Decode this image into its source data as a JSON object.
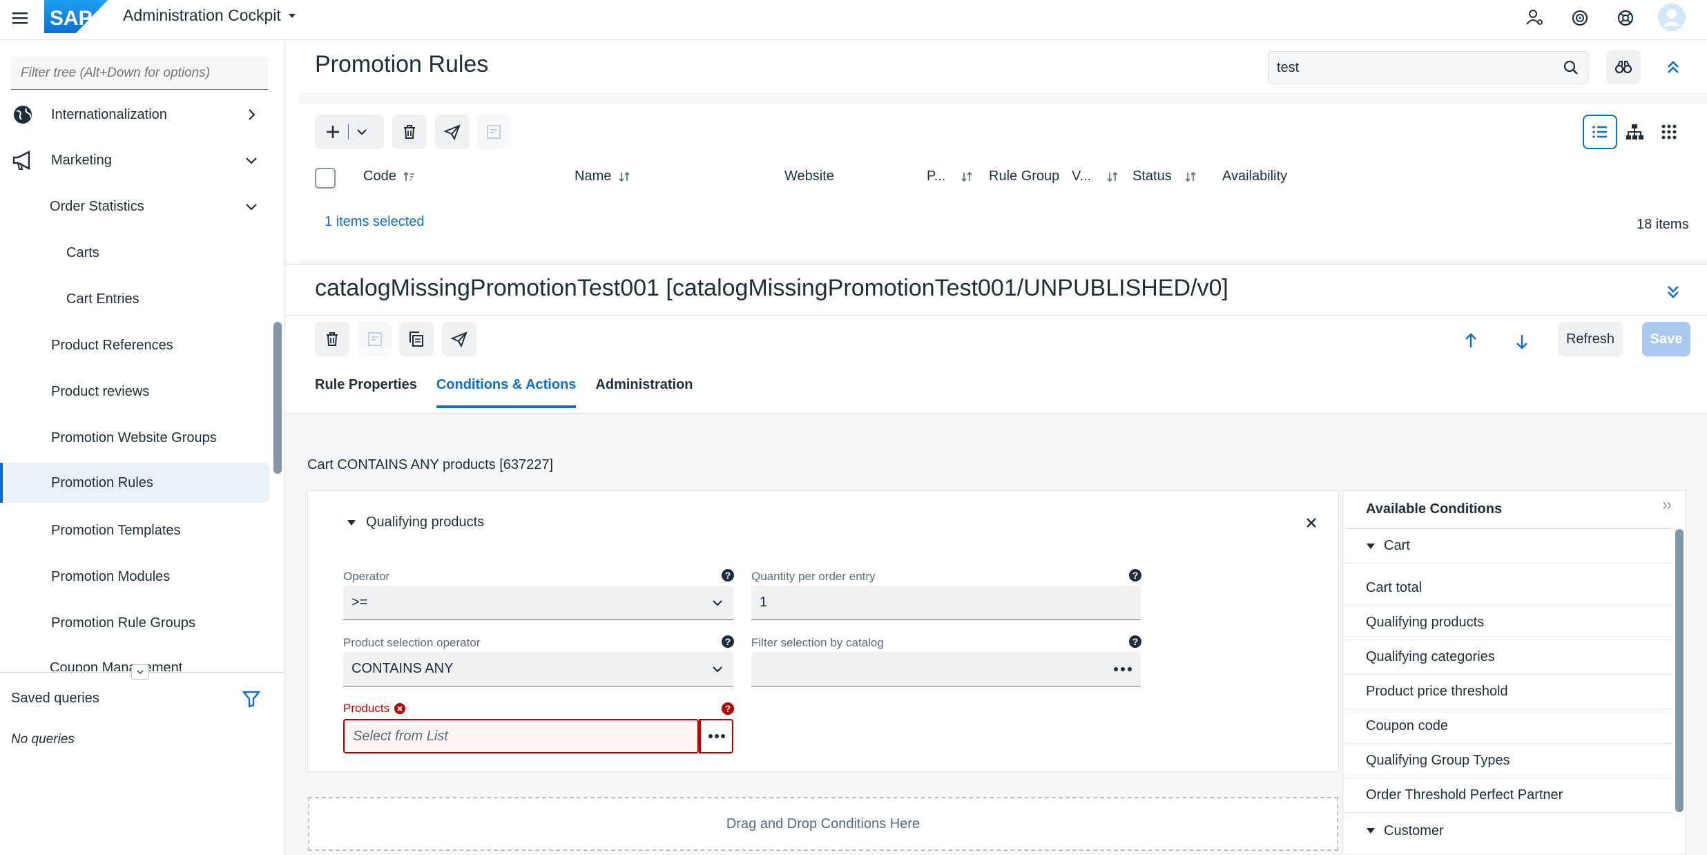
{
  "shell": {
    "app_title": "Administration Cockpit",
    "logo_text": "SAP"
  },
  "sidebar": {
    "filter_placeholder": "Filter tree (Alt+Down for options)",
    "items": [
      {
        "label": "Internationalization"
      },
      {
        "label": "Marketing"
      },
      {
        "label": "Order Statistics"
      },
      {
        "label": "Carts"
      },
      {
        "label": "Cart Entries"
      },
      {
        "label": "Product References"
      },
      {
        "label": "Product reviews"
      },
      {
        "label": "Promotion Website Groups"
      },
      {
        "label": "Promotion Rules"
      },
      {
        "label": "Promotion Templates"
      },
      {
        "label": "Promotion Modules"
      },
      {
        "label": "Promotion Rule Groups"
      },
      {
        "label": "Coupon Management"
      }
    ],
    "saved_queries": "Saved queries",
    "no_queries": "No queries"
  },
  "list": {
    "title": "Promotion Rules",
    "search_value": "test",
    "columns": [
      "Code",
      "Name",
      "Website",
      "P...",
      "Rule Group",
      "V...",
      "Status",
      "Availability"
    ],
    "selected_text": "1 items selected",
    "items_count": "18 items"
  },
  "detail": {
    "title": "catalogMissingPromotionTest001 [catalogMissingPromotionTest001/UNPUBLISHED/v0]",
    "refresh_label": "Refresh",
    "save_label": "Save",
    "tabs": [
      "Rule Properties",
      "Conditions & Actions",
      "Administration"
    ],
    "active_tab": "Conditions & Actions"
  },
  "conditions": {
    "summary": "Cart CONTAINS ANY products [637227]",
    "card_title": "Qualifying products",
    "operator_label": "Operator",
    "operator_value": ">=",
    "quantity_label": "Quantity per order entry",
    "quantity_value": "1",
    "selection_operator_label": "Product selection operator",
    "selection_operator_value": "CONTAINS ANY",
    "filter_catalog_label": "Filter selection by catalog",
    "products_label": "Products",
    "products_placeholder": "Select from List",
    "drop_zone": "Drag and Drop Conditions Here"
  },
  "available": {
    "title": "Available Conditions",
    "groups": [
      {
        "label": "Cart"
      },
      {
        "label": "Customer"
      }
    ],
    "items": [
      "Cart total",
      "Qualifying products",
      "Qualifying categories",
      "Product price threshold",
      "Coupon code",
      "Qualifying Group Types",
      "Order Threshold Perfect Partner"
    ]
  },
  "colors": {
    "accent": "#0a6ed1",
    "error": "#bb0000",
    "text": "#1d2d3e",
    "save_disabled": "#a9c9ef"
  }
}
